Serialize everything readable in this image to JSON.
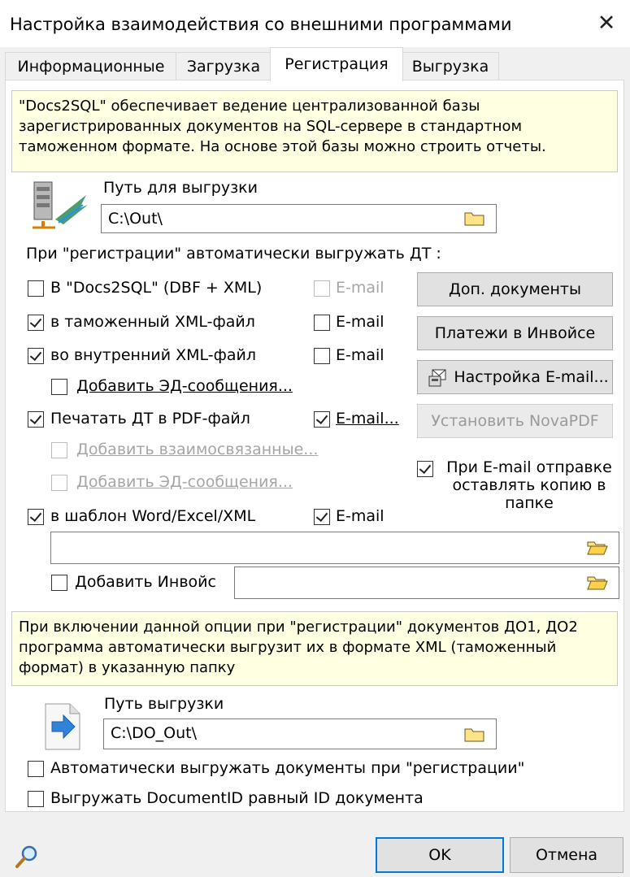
{
  "window": {
    "title": "Настройка взаимодействия со внешними программами"
  },
  "tabs": [
    {
      "label": "Информационные"
    },
    {
      "label": "Загрузка"
    },
    {
      "label": "Регистрация"
    },
    {
      "label": "Выгрузка"
    }
  ],
  "note1": "\"Docs2SQL\" обеспечивает ведение централизованной базы зарегистрированных документов на SQL-сервере в стандартном таможенном формате. На основе этой базы можно строить отчеты.",
  "export_path": {
    "label": "Путь для выгрузки",
    "value": "C:\\Out\\"
  },
  "auto_export_label": "При \"регистрации\" автоматически выгружать ДТ :",
  "options": {
    "docs2sql": {
      "label": "В \"Docs2SQL\" (DBF + XML)",
      "checked": false
    },
    "customs_xml": {
      "label": "в таможенный XML-файл",
      "checked": true
    },
    "internal_xml": {
      "label": "во внутренний XML-файл",
      "checked": true
    },
    "add_ed_messages": {
      "label": "Добавить ЭД-сообщения...",
      "checked": false
    },
    "print_pdf": {
      "label": "Печатать ДТ в PDF-файл",
      "checked": true
    },
    "add_related": {
      "label": "Добавить взаимосвязанные...",
      "checked": false
    },
    "add_ed_messages_pdf": {
      "label": "Добавить ЭД-сообщения...",
      "checked": false
    },
    "template": {
      "label": "в шаблон Word/Excel/XML",
      "checked": true
    },
    "add_invoice": {
      "label": "Добавить Инвойс",
      "checked": false
    }
  },
  "email": {
    "docs2sql": "E-mail",
    "customs_xml": "E-mail",
    "internal_xml": "E-mail",
    "print_pdf": "E-mail...",
    "template": "E-mail"
  },
  "buttons": {
    "extra_docs": "Доп. документы",
    "invoice_payments": "Платежи в Инвойсе",
    "email_settings": "Настройка E-mail...",
    "install_novapdf": "Установить NovaPDF",
    "ok": "OK",
    "cancel": "Отмена"
  },
  "keep_copy": {
    "label": "При E-mail отправке оставлять копию в папке",
    "checked": true
  },
  "template_path": {
    "value": ""
  },
  "invoice_path": {
    "value": ""
  },
  "note2": "При включении данной опции при \"регистрации\" документов ДО1, ДО2 программа автоматически выгрузит их в формате XML (таможенный формат) в указанную папку",
  "do_export": {
    "label": "Путь выгрузки",
    "value": "C:\\DO_Out\\"
  },
  "auto_export_docs": {
    "label": "Автоматически выгружать документы при \"регистрации\"",
    "checked": false
  },
  "document_id": {
    "label": "Выгружать DocumentID равный ID документа",
    "checked": false
  },
  "colors": {
    "note_bg": "#ffffe1",
    "accent": "#0078d7"
  }
}
